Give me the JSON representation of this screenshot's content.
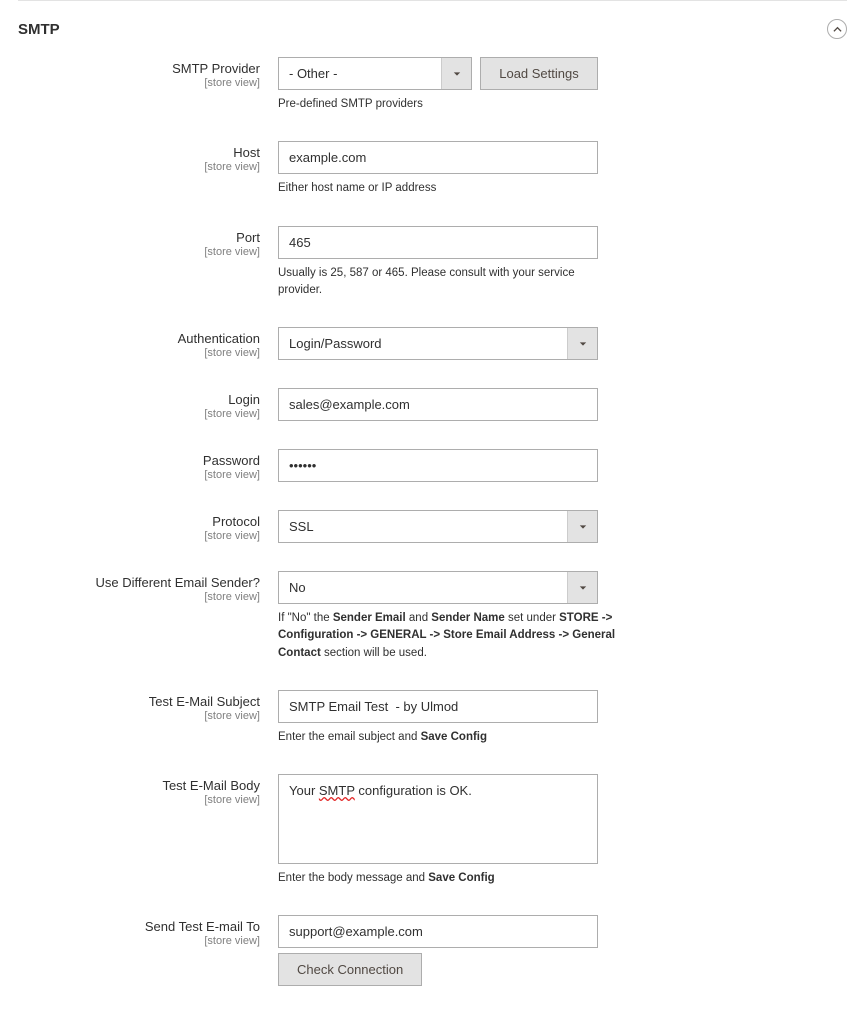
{
  "section": {
    "title": "SMTP"
  },
  "scopeText": "[store view]",
  "provider": {
    "label": "SMTP Provider",
    "value": "- Other -",
    "loadBtn": "Load Settings",
    "help": "Pre-defined SMTP providers"
  },
  "host": {
    "label": "Host",
    "value": "example.com",
    "help": "Either host name or IP address"
  },
  "port": {
    "label": "Port",
    "value": "465",
    "help": "Usually is 25, 587 or 465. Please consult with your service provider."
  },
  "auth": {
    "label": "Authentication",
    "value": "Login/Password"
  },
  "login": {
    "label": "Login",
    "value": "sales@example.com"
  },
  "password": {
    "label": "Password",
    "value": "••••••"
  },
  "protocol": {
    "label": "Protocol",
    "value": "SSL"
  },
  "diffSender": {
    "label": "Use Different Email Sender?",
    "value": "No",
    "help_pre": "If \"No\" the ",
    "help_b1": "Sender Email",
    "help_mid1": " and ",
    "help_b2": "Sender Name",
    "help_mid2": " set under ",
    "help_b3": "STORE -> Configuration -> GENERAL -> Store Email Address -> General Contact",
    "help_post": " section will be used."
  },
  "testSubject": {
    "label": "Test E-Mail Subject",
    "value": "SMTP Email Test  - by Ulmod",
    "help_pre": "Enter the email subject and ",
    "help_b": "Save Config"
  },
  "testBody": {
    "label": "Test E-Mail Body",
    "value_pre": "Your ",
    "value_wave": "SMTP",
    "value_post": " configuration is OK.",
    "help_pre": "Enter the body message and ",
    "help_b": "Save Config"
  },
  "sendTo": {
    "label": "Send Test E-mail To",
    "value": "support@example.com",
    "checkBtn": "Check Connection"
  }
}
